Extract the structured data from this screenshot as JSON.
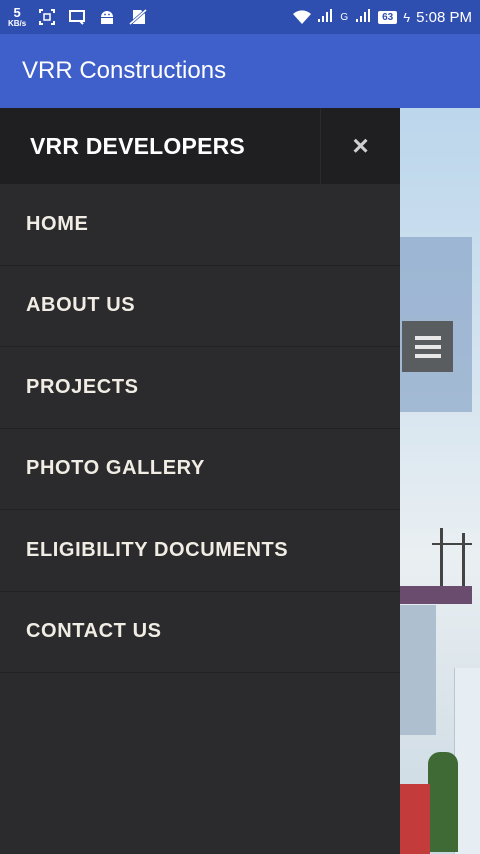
{
  "status_bar": {
    "speed_value": "5",
    "speed_unit": "KB/s",
    "battery": "63",
    "time": "5:08 PM",
    "network_label": "G",
    "icons": [
      "screenshot-icon",
      "cast-icon",
      "android-icon",
      "no-sim-icon",
      "wifi-icon",
      "signal-icon",
      "charging-icon"
    ]
  },
  "app_bar": {
    "title": "VRR Constructions",
    "color": "#3f5fca"
  },
  "drawer": {
    "title": "VRR DEVELOPERS",
    "close_label": "×",
    "items": [
      {
        "label": "HOME"
      },
      {
        "label": "ABOUT US"
      },
      {
        "label": "PROJECTS"
      },
      {
        "label": "PHOTO GALLERY"
      },
      {
        "label": "ELIGIBILITY DOCUMENTS"
      },
      {
        "label": "CONTACT US"
      }
    ]
  }
}
